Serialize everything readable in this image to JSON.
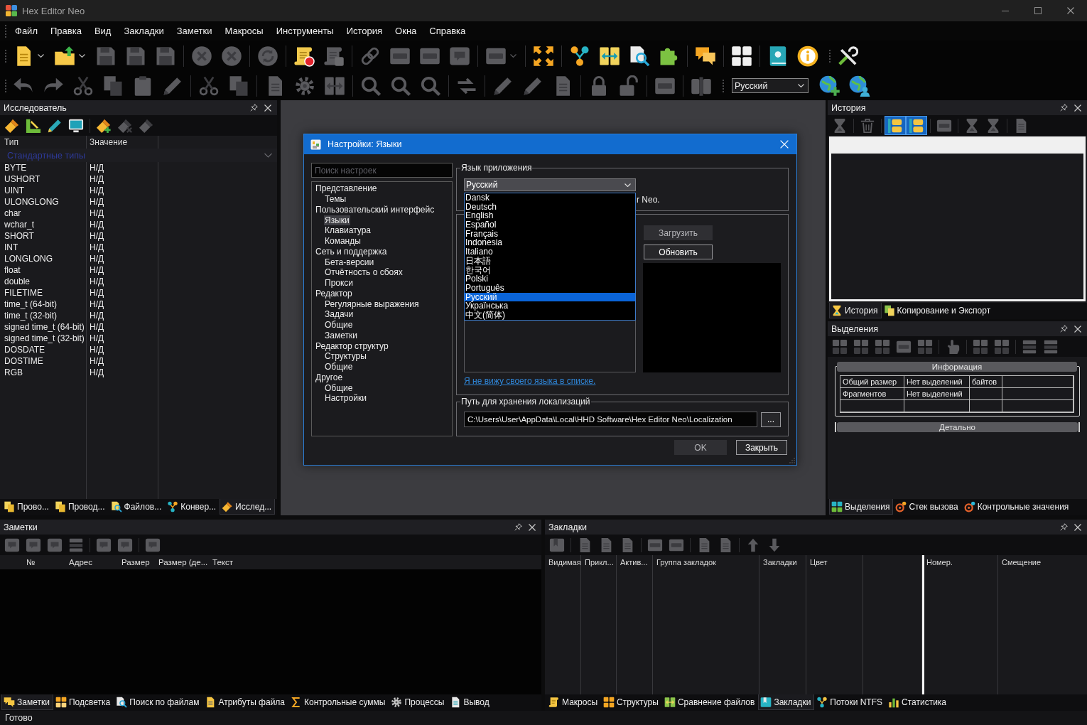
{
  "window": {
    "title": "Hex Editor Neo"
  },
  "menu": [
    "Файл",
    "Правка",
    "Вид",
    "Закладки",
    "Заметки",
    "Макросы",
    "Инструменты",
    "История",
    "Окна",
    "Справка"
  ],
  "toolbar": {
    "rows": [
      {
        "bands": [
          {
            "groups": [
              [
                {
                  "kind": "split",
                  "disabled": false
                },
                {
                  "kind": "split",
                  "disabled": false
                },
                {
                  "kind": "button",
                  "disabled": true
                },
                {
                  "kind": "button",
                  "disabled": true
                },
                {
                  "kind": "button",
                  "disabled": true
                }
              ],
              [
                {
                  "kind": "button",
                  "disabled": true
                },
                {
                  "kind": "button",
                  "disabled": true
                }
              ],
              [
                {
                  "kind": "button",
                  "disabled": true
                }
              ],
              [
                {
                  "kind": "button",
                  "disabled": false
                },
                {
                  "kind": "button",
                  "disabled": true
                }
              ],
              [
                {
                  "kind": "button",
                  "disabled": true
                },
                {
                  "kind": "button",
                  "disabled": true
                },
                {
                  "kind": "button",
                  "disabled": true
                },
                {
                  "kind": "button",
                  "disabled": true
                }
              ],
              [
                {
                  "kind": "split",
                  "disabled": true
                }
              ],
              [
                {
                  "kind": "button",
                  "disabled": false
                }
              ],
              [
                {
                  "kind": "button",
                  "disabled": false
                },
                {
                  "kind": "button",
                  "disabled": false
                },
                {
                  "kind": "button",
                  "disabled": false
                },
                {
                  "kind": "button",
                  "disabled": false
                }
              ],
              [
                {
                  "kind": "button",
                  "disabled": false
                }
              ],
              [
                {
                  "kind": "button",
                  "disabled": false
                }
              ],
              [
                {
                  "kind": "button",
                  "disabled": false
                },
                {
                  "kind": "button",
                  "disabled": false
                }
              ]
            ]
          },
          {
            "groups": [
              [
                {
                  "kind": "button",
                  "disabled": false
                }
              ]
            ]
          }
        ]
      },
      {
        "bands": [
          {
            "groups": [
              [
                {
                  "kind": "button",
                  "disabled": true
                },
                {
                  "kind": "button",
                  "disabled": true
                },
                {
                  "kind": "button",
                  "disabled": true
                },
                {
                  "kind": "button",
                  "disabled": true
                },
                {
                  "kind": "button",
                  "disabled": true
                },
                {
                  "kind": "button",
                  "disabled": true
                }
              ],
              [
                {
                  "kind": "button",
                  "disabled": true
                },
                {
                  "kind": "button",
                  "disabled": true
                }
              ],
              [
                {
                  "kind": "button",
                  "disabled": true
                },
                {
                  "kind": "button",
                  "disabled": true
                },
                {
                  "kind": "button",
                  "disabled": true
                }
              ],
              [
                {
                  "kind": "button",
                  "disabled": true
                },
                {
                  "kind": "button",
                  "disabled": true
                },
                {
                  "kind": "button",
                  "disabled": true
                }
              ],
              [
                {
                  "kind": "button",
                  "disabled": true
                }
              ],
              [
                {
                  "kind": "button",
                  "disabled": true
                },
                {
                  "kind": "button",
                  "disabled": true
                },
                {
                  "kind": "button",
                  "disabled": true
                }
              ],
              [
                {
                  "kind": "button",
                  "disabled": true
                },
                {
                  "kind": "button",
                  "disabled": true
                }
              ],
              [
                {
                  "kind": "button",
                  "disabled": true
                }
              ],
              [
                {
                  "kind": "button",
                  "disabled": true
                }
              ]
            ]
          },
          {
            "language_select": "Русский",
            "groups": [
              [
                {
                  "kind": "button",
                  "disabled": false
                },
                {
                  "kind": "button",
                  "disabled": false
                }
              ]
            ]
          }
        ]
      }
    ]
  },
  "explorer": {
    "title": "Исследователь",
    "toolbar": [
      [
        {
          "disabled": false
        },
        {
          "disabled": false
        },
        {
          "disabled": false
        },
        {
          "disabled": false
        }
      ],
      [
        {
          "disabled": false
        },
        {
          "disabled": true
        },
        {
          "disabled": true
        }
      ]
    ],
    "columns": [
      "Тип",
      "Значение"
    ],
    "group": {
      "label": "Стандартные типы",
      "expanded": true
    },
    "rows": [
      {
        "type": "BYTE",
        "value": "Н/Д"
      },
      {
        "type": "USHORT",
        "value": "Н/Д"
      },
      {
        "type": "UINT",
        "value": "Н/Д"
      },
      {
        "type": "ULONGLONG",
        "value": "Н/Д"
      },
      {
        "type": "char",
        "value": "Н/Д"
      },
      {
        "type": "wchar_t",
        "value": "Н/Д"
      },
      {
        "type": "SHORT",
        "value": "Н/Д"
      },
      {
        "type": "INT",
        "value": "Н/Д"
      },
      {
        "type": "LONGLONG",
        "value": "Н/Д"
      },
      {
        "type": "float",
        "value": "Н/Д"
      },
      {
        "type": "double",
        "value": "Н/Д"
      },
      {
        "type": "FILETIME",
        "value": "Н/Д"
      },
      {
        "type": "time_t (64-bit)",
        "value": "Н/Д"
      },
      {
        "type": "time_t (32-bit)",
        "value": "Н/Д"
      },
      {
        "type": "signed time_t (64-bit)",
        "value": "Н/Д"
      },
      {
        "type": "signed time_t (32-bit)",
        "value": "Н/Д"
      },
      {
        "type": "DOSDATE",
        "value": "Н/Д"
      },
      {
        "type": "DOSTIME",
        "value": "Н/Д"
      },
      {
        "type": "RGB",
        "value": "Н/Д"
      }
    ],
    "tabs": [
      {
        "label": "Прово...",
        "selected": false
      },
      {
        "label": "Провод...",
        "selected": false
      },
      {
        "label": "Файлов...",
        "selected": false
      },
      {
        "label": "Конвер...",
        "selected": false
      },
      {
        "label": "Исслед...",
        "selected": true
      }
    ]
  },
  "settings_dialog": {
    "title": "Настройки: Языки",
    "search": {
      "placeholder": "Поиск настроек"
    },
    "tree": [
      {
        "label": "Представление",
        "selected": false,
        "children": [
          {
            "label": "Темы",
            "selected": false
          }
        ]
      },
      {
        "label": "Пользовательский интерфейс",
        "selected": false,
        "children": [
          {
            "label": "Языки",
            "selected": true
          },
          {
            "label": "Клавиатура",
            "selected": false
          },
          {
            "label": "Команды",
            "selected": false
          }
        ]
      },
      {
        "label": "Сеть и поддержка",
        "selected": false,
        "children": [
          {
            "label": "Бета-версии",
            "selected": false
          },
          {
            "label": "Отчётность о сбоях",
            "selected": false
          },
          {
            "label": "Прокси",
            "selected": false
          }
        ]
      },
      {
        "label": "Редактор",
        "selected": false,
        "children": [
          {
            "label": "Регулярные выражения",
            "selected": false
          },
          {
            "label": "Задачи",
            "selected": false
          },
          {
            "label": "Общие",
            "selected": false
          },
          {
            "label": "Заметки",
            "selected": false
          }
        ]
      },
      {
        "label": "Редактор структур",
        "selected": false,
        "children": [
          {
            "label": "Структуры",
            "selected": false
          },
          {
            "label": "Общие",
            "selected": false
          }
        ]
      },
      {
        "label": "Другое",
        "selected": false,
        "children": [
          {
            "label": "Общие",
            "selected": false
          },
          {
            "label": "Настройки",
            "selected": false
          }
        ]
      }
    ],
    "language_group": {
      "title": "Язык приложения",
      "select": {
        "value": "Русский",
        "expanded": true,
        "options": [
          {
            "label": "Dansk",
            "selected": false
          },
          {
            "label": "Deutsch",
            "selected": false
          },
          {
            "label": "English",
            "selected": false
          },
          {
            "label": "Español",
            "selected": false
          },
          {
            "label": "Français",
            "selected": false
          },
          {
            "label": "Indonesia",
            "selected": false
          },
          {
            "label": "Italiano",
            "selected": false
          },
          {
            "label": "日本語",
            "selected": false
          },
          {
            "label": "한국어",
            "selected": false
          },
          {
            "label": "Polski",
            "selected": false
          },
          {
            "label": "Português",
            "selected": false
          },
          {
            "label": "Русский",
            "selected": true
          },
          {
            "label": "Українська",
            "selected": false
          },
          {
            "label": "中文(简体)",
            "selected": false
          }
        ]
      },
      "note": "r Neo."
    },
    "load_button": {
      "label": "Загрузить",
      "disabled": true
    },
    "update_button": {
      "label": "Обновить",
      "disabled": false
    },
    "link": "Я не вижу своего языка в списке.",
    "path_group": {
      "title": "Путь для хранения локализаций",
      "value": "C:\\Users\\User\\AppData\\Local\\HHD Software\\Hex Editor Neo\\Localization",
      "browse": "..."
    },
    "buttons": [
      {
        "label": "OK",
        "disabled": true
      },
      {
        "label": "Закрыть",
        "disabled": false
      }
    ]
  },
  "history": {
    "title": "История",
    "toolbar": [
      [
        {
          "disabled": true,
          "checked": false
        }
      ],
      [
        {
          "disabled": true,
          "checked": false
        }
      ],
      [
        {
          "disabled": false,
          "checked": true
        },
        {
          "disabled": false,
          "checked": true
        }
      ],
      [
        {
          "disabled": true,
          "checked": false
        }
      ],
      [
        {
          "disabled": true,
          "checked": false
        },
        {
          "disabled": true,
          "checked": false
        }
      ],
      [
        {
          "disabled": true,
          "checked": false
        }
      ]
    ],
    "tabs": [
      {
        "label": "История",
        "selected": true
      },
      {
        "label": "Копирование и Экспорт",
        "selected": false
      }
    ]
  },
  "selections": {
    "title": "Выделения",
    "toolbar": [
      [
        {
          "disabled": true
        },
        {
          "disabled": true
        },
        {
          "disabled": true
        },
        {
          "disabled": true
        },
        {
          "disabled": true
        }
      ],
      [
        {
          "disabled": true
        }
      ],
      [
        {
          "disabled": true
        },
        {
          "disabled": true
        }
      ],
      [
        {
          "disabled": true
        },
        {
          "disabled": true
        }
      ]
    ],
    "sections": [
      {
        "title": "Информация",
        "expanded": true,
        "rows": [
          [
            "Общий размер",
            "Нет выделений",
            "байтов"
          ],
          [
            "Фрагментов",
            "Нет выделений"
          ]
        ]
      },
      {
        "title": "Детально",
        "expanded": false
      }
    ],
    "tabs": [
      {
        "label": "Выделения",
        "selected": true
      },
      {
        "label": "Стек вызова",
        "selected": false
      },
      {
        "label": "Контрольные значения",
        "selected": false
      }
    ]
  },
  "notes": {
    "title": "Заметки",
    "toolbar": [
      [
        {
          "disabled": true
        },
        {
          "disabled": true
        },
        {
          "disabled": true
        },
        {
          "disabled": true
        }
      ],
      [
        {
          "disabled": true
        },
        {
          "disabled": true
        }
      ],
      [
        {
          "disabled": true
        }
      ]
    ],
    "columns": [
      "№",
      "Адрес",
      "Размер",
      "Размер (де...",
      "Текст"
    ],
    "tabs": [
      {
        "label": "Заметки",
        "selected": true
      },
      {
        "label": "Подсветка",
        "selected": false
      },
      {
        "label": "Поиск по файлам",
        "selected": false
      },
      {
        "label": "Атрибуты файла",
        "selected": false
      },
      {
        "label": "Контрольные суммы",
        "selected": false
      },
      {
        "label": "Процессы",
        "selected": false
      },
      {
        "label": "Вывод",
        "selected": false
      }
    ]
  },
  "bookmarks": {
    "title": "Закладки",
    "toolbar": [
      [
        {
          "disabled": true
        }
      ],
      [
        {
          "disabled": true
        },
        {
          "disabled": true
        },
        {
          "disabled": true
        }
      ],
      [
        {
          "disabled": true
        },
        {
          "disabled": true
        }
      ],
      [
        {
          "disabled": true
        },
        {
          "disabled": true
        }
      ],
      [
        {
          "disabled": true
        },
        {
          "disabled": true
        }
      ]
    ],
    "columns": [
      "Видимая",
      "Прикл...",
      "Актив...",
      "Группа закладок",
      "Закладки",
      "Цвет"
    ],
    "detail_columns": [
      "Номер.",
      "Смещение"
    ],
    "tabs": [
      {
        "label": "Макросы",
        "selected": false
      },
      {
        "label": "Структуры",
        "selected": false
      },
      {
        "label": "Сравнение файлов",
        "selected": false
      },
      {
        "label": "Закладки",
        "selected": true
      },
      {
        "label": "Потоки NTFS",
        "selected": false
      },
      {
        "label": "Статистика",
        "selected": false
      }
    ]
  },
  "status_bar": {
    "text": "Готово"
  }
}
